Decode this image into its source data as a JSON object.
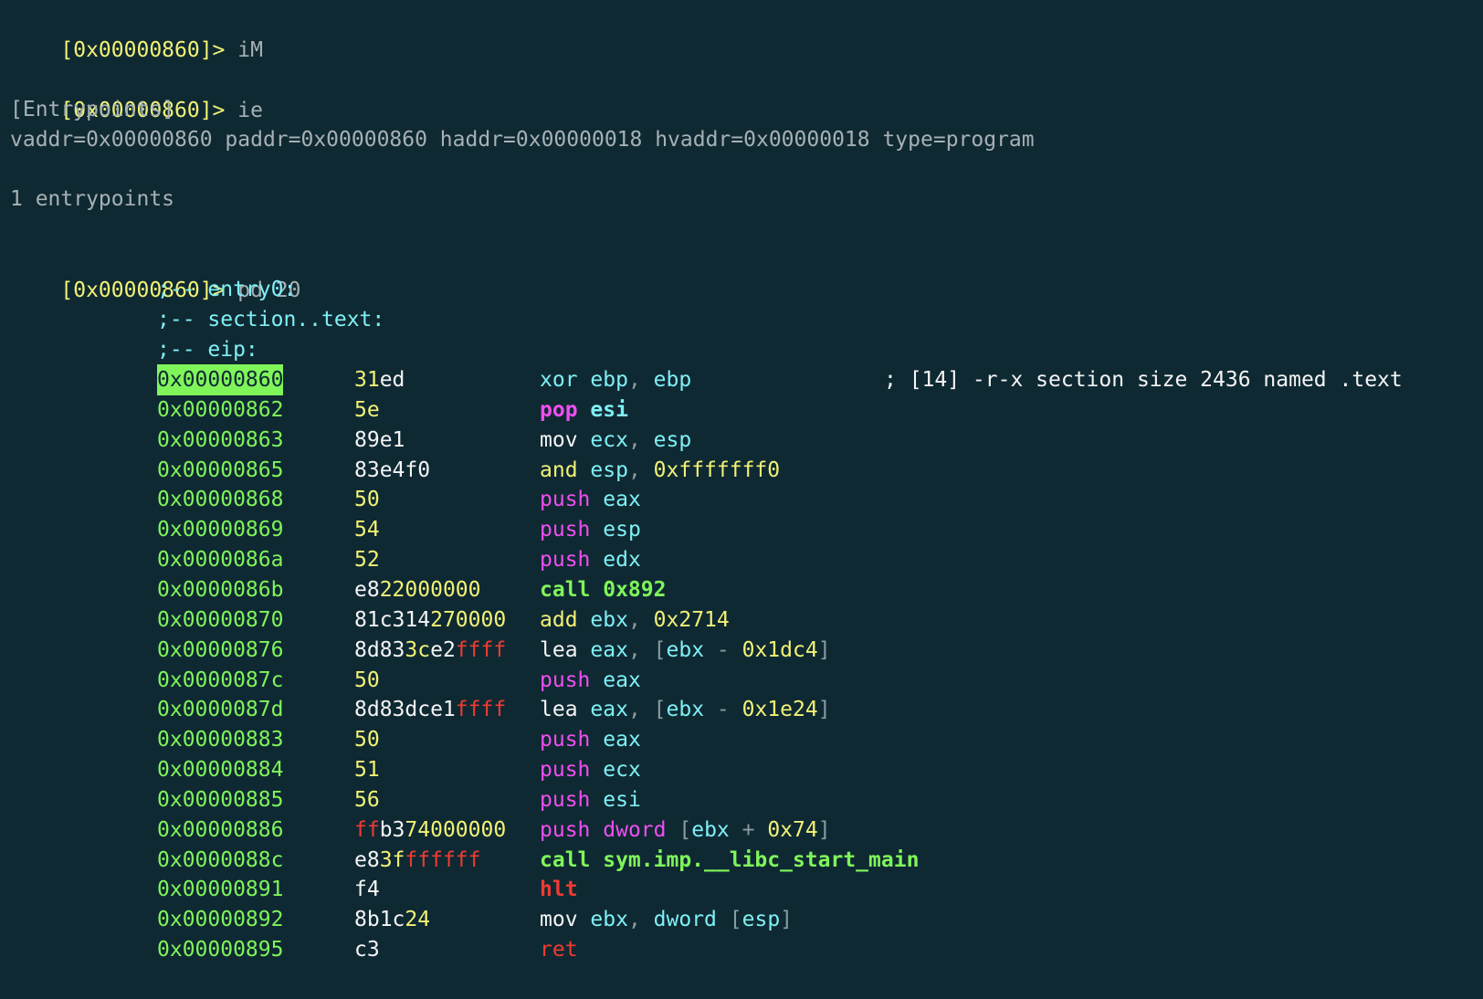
{
  "prompt": "[0x00000860]>",
  "blocks": {
    "cmd1": "iM",
    "cmd2": "ie",
    "entry_header": "[Entrypoints]",
    "entry_line": "vaddr=0x00000860 paddr=0x00000860 haddr=0x00000018 hvaddr=0x00000018 type=program",
    "entry_count": "1 entrypoints",
    "cmd3": "pd 20"
  },
  "flags": [
    ";-- entry0:",
    ";-- section..text:",
    ";-- eip:"
  ],
  "disasm": [
    {
      "addr": "0x00000860",
      "current": true,
      "bytes": [
        {
          "t": "31",
          "c": "y"
        },
        {
          "t": "ed",
          "c": "w"
        }
      ],
      "mnem": [
        {
          "t": "xor",
          "c": "c"
        },
        {
          "t": " ",
          "c": "w"
        },
        {
          "t": "ebp",
          "c": "c"
        },
        {
          "t": ", ",
          "c": "gray"
        },
        {
          "t": "ebp",
          "c": "c"
        }
      ],
      "comment": "; [14] -r-x section size 2436 named .text"
    },
    {
      "addr": "0x00000862",
      "bytes": [
        {
          "t": "5e",
          "c": "y"
        }
      ],
      "mnem": [
        {
          "t": "pop",
          "c": "m",
          "b": true
        },
        {
          "t": " ",
          "c": "w"
        },
        {
          "t": "esi",
          "c": "c",
          "b": true
        }
      ]
    },
    {
      "addr": "0x00000863",
      "bytes": [
        {
          "t": "89e1",
          "c": "w"
        }
      ],
      "mnem": [
        {
          "t": "mov",
          "c": "w"
        },
        {
          "t": " ",
          "c": "w"
        },
        {
          "t": "ecx",
          "c": "c"
        },
        {
          "t": ", ",
          "c": "gray"
        },
        {
          "t": "esp",
          "c": "c"
        }
      ]
    },
    {
      "addr": "0x00000865",
      "bytes": [
        {
          "t": "83e4f0",
          "c": "w"
        }
      ],
      "mnem": [
        {
          "t": "and",
          "c": "y"
        },
        {
          "t": " ",
          "c": "w"
        },
        {
          "t": "esp",
          "c": "c"
        },
        {
          "t": ", ",
          "c": "gray"
        },
        {
          "t": "0xfffffff0",
          "c": "y"
        }
      ]
    },
    {
      "addr": "0x00000868",
      "bytes": [
        {
          "t": "50",
          "c": "y"
        }
      ],
      "mnem": [
        {
          "t": "push",
          "c": "m"
        },
        {
          "t": " ",
          "c": "w"
        },
        {
          "t": "eax",
          "c": "c"
        }
      ]
    },
    {
      "addr": "0x00000869",
      "bytes": [
        {
          "t": "54",
          "c": "y"
        }
      ],
      "mnem": [
        {
          "t": "push",
          "c": "m"
        },
        {
          "t": " ",
          "c": "w"
        },
        {
          "t": "esp",
          "c": "c"
        }
      ]
    },
    {
      "addr": "0x0000086a",
      "bytes": [
        {
          "t": "52",
          "c": "y"
        }
      ],
      "mnem": [
        {
          "t": "push",
          "c": "m"
        },
        {
          "t": " ",
          "c": "w"
        },
        {
          "t": "edx",
          "c": "c"
        }
      ]
    },
    {
      "addr": "0x0000086b",
      "bytes": [
        {
          "t": "e8",
          "c": "w"
        },
        {
          "t": "22000000",
          "c": "y"
        }
      ],
      "mnem": [
        {
          "t": "call 0x892",
          "c": "g",
          "b": true
        }
      ]
    },
    {
      "addr": "0x00000870",
      "bytes": [
        {
          "t": "81c314",
          "c": "w"
        },
        {
          "t": "27",
          "c": "y"
        },
        {
          "t": "0000",
          "c": "y"
        }
      ],
      "mnem": [
        {
          "t": "add",
          "c": "y"
        },
        {
          "t": " ",
          "c": "w"
        },
        {
          "t": "ebx",
          "c": "c"
        },
        {
          "t": ", ",
          "c": "gray"
        },
        {
          "t": "0x2714",
          "c": "y"
        }
      ]
    },
    {
      "addr": "0x00000876",
      "bytes": [
        {
          "t": "8d83",
          "c": "w"
        },
        {
          "t": "3c",
          "c": "y"
        },
        {
          "t": "e2",
          "c": "w"
        },
        {
          "t": "ffff",
          "c": "r"
        }
      ],
      "mnem": [
        {
          "t": "lea",
          "c": "w"
        },
        {
          "t": " ",
          "c": "w"
        },
        {
          "t": "eax",
          "c": "c"
        },
        {
          "t": ", ",
          "c": "gray"
        },
        {
          "t": "[",
          "c": "gray"
        },
        {
          "t": "ebx",
          "c": "c"
        },
        {
          "t": " - ",
          "c": "gray"
        },
        {
          "t": "0x1dc4",
          "c": "y"
        },
        {
          "t": "]",
          "c": "gray"
        }
      ]
    },
    {
      "addr": "0x0000087c",
      "bytes": [
        {
          "t": "50",
          "c": "y"
        }
      ],
      "mnem": [
        {
          "t": "push",
          "c": "m"
        },
        {
          "t": " ",
          "c": "w"
        },
        {
          "t": "eax",
          "c": "c"
        }
      ]
    },
    {
      "addr": "0x0000087d",
      "bytes": [
        {
          "t": "8d83dce1",
          "c": "w"
        },
        {
          "t": "ffff",
          "c": "r"
        }
      ],
      "mnem": [
        {
          "t": "lea",
          "c": "w"
        },
        {
          "t": " ",
          "c": "w"
        },
        {
          "t": "eax",
          "c": "c"
        },
        {
          "t": ", ",
          "c": "gray"
        },
        {
          "t": "[",
          "c": "gray"
        },
        {
          "t": "ebx",
          "c": "c"
        },
        {
          "t": " - ",
          "c": "gray"
        },
        {
          "t": "0x1e24",
          "c": "y"
        },
        {
          "t": "]",
          "c": "gray"
        }
      ]
    },
    {
      "addr": "0x00000883",
      "bytes": [
        {
          "t": "50",
          "c": "y"
        }
      ],
      "mnem": [
        {
          "t": "push",
          "c": "m"
        },
        {
          "t": " ",
          "c": "w"
        },
        {
          "t": "eax",
          "c": "c"
        }
      ]
    },
    {
      "addr": "0x00000884",
      "bytes": [
        {
          "t": "51",
          "c": "y"
        }
      ],
      "mnem": [
        {
          "t": "push",
          "c": "m"
        },
        {
          "t": " ",
          "c": "w"
        },
        {
          "t": "ecx",
          "c": "c"
        }
      ]
    },
    {
      "addr": "0x00000885",
      "bytes": [
        {
          "t": "56",
          "c": "y"
        }
      ],
      "mnem": [
        {
          "t": "push",
          "c": "m"
        },
        {
          "t": " ",
          "c": "w"
        },
        {
          "t": "esi",
          "c": "c"
        }
      ]
    },
    {
      "addr": "0x00000886",
      "bytes": [
        {
          "t": "ff",
          "c": "r"
        },
        {
          "t": "b3",
          "c": "w"
        },
        {
          "t": "74",
          "c": "y"
        },
        {
          "t": "000000",
          "c": "y"
        }
      ],
      "mnem": [
        {
          "t": "push",
          "c": "m"
        },
        {
          "t": " ",
          "c": "w"
        },
        {
          "t": "dword",
          "c": "m"
        },
        {
          "t": " ",
          "c": "w"
        },
        {
          "t": "[",
          "c": "gray"
        },
        {
          "t": "ebx",
          "c": "c"
        },
        {
          "t": " + ",
          "c": "gray"
        },
        {
          "t": "0x74",
          "c": "y"
        },
        {
          "t": "]",
          "c": "gray"
        }
      ]
    },
    {
      "addr": "0x0000088c",
      "bytes": [
        {
          "t": "e8",
          "c": "w"
        },
        {
          "t": "3f",
          "c": "y"
        },
        {
          "t": "ffffff",
          "c": "r"
        }
      ],
      "mnem": [
        {
          "t": "call sym.imp.__libc_start_main",
          "c": "g",
          "b": true
        }
      ]
    },
    {
      "addr": "0x00000891",
      "bytes": [
        {
          "t": "f4",
          "c": "w"
        }
      ],
      "mnem": [
        {
          "t": "hlt",
          "c": "r",
          "b": true
        }
      ]
    },
    {
      "addr": "0x00000892",
      "bytes": [
        {
          "t": "8b1c",
          "c": "w"
        },
        {
          "t": "24",
          "c": "y"
        }
      ],
      "mnem": [
        {
          "t": "mov",
          "c": "w"
        },
        {
          "t": " ",
          "c": "w"
        },
        {
          "t": "ebx",
          "c": "c"
        },
        {
          "t": ", ",
          "c": "gray"
        },
        {
          "t": "dword",
          "c": "c"
        },
        {
          "t": " ",
          "c": "w"
        },
        {
          "t": "[",
          "c": "gray"
        },
        {
          "t": "esp",
          "c": "c"
        },
        {
          "t": "]",
          "c": "gray"
        }
      ]
    },
    {
      "addr": "0x00000895",
      "bytes": [
        {
          "t": "c3",
          "c": "w"
        }
      ],
      "mnem": [
        {
          "t": "ret",
          "c": "r"
        }
      ]
    }
  ],
  "colors": {
    "background": "#0f2933",
    "prompt": "#f2f275",
    "address": "#7ff55a",
    "flag": "#7ff0f5",
    "magenta": "#f04ef0",
    "red": "#ef3b33",
    "text": "#a6b1b4"
  }
}
